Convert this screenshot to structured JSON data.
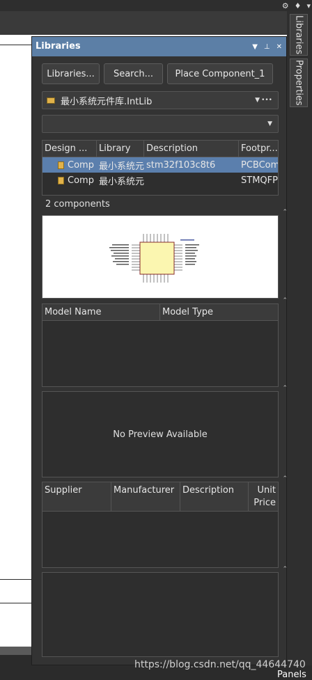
{
  "top_icons": [
    "gear-icon",
    "bell-icon",
    "user-icon"
  ],
  "panel": {
    "title": "Libraries",
    "buttons": {
      "libraries": "Libraries...",
      "search": "Search...",
      "place": "Place Component_1"
    },
    "library_select": "最小系统元件库.IntLib",
    "filter_value": "",
    "table": {
      "headers": [
        "Design ...",
        "Library",
        "Description",
        "Footpr..."
      ],
      "rows": [
        [
          "Comp",
          "最小系统元",
          "stm32f103c8t6",
          "PCBCom"
        ],
        [
          "Comp",
          "最小系统元",
          "",
          "STMQFP"
        ]
      ]
    },
    "count_text": "2 components",
    "models": {
      "headers": [
        "Model Name",
        "Model Type"
      ]
    },
    "no_preview": "No Preview Available",
    "supplier": {
      "headers": [
        "Supplier",
        "Manufacturer",
        "Description",
        "Unit Price"
      ]
    }
  },
  "side_tabs": [
    "Libraries",
    "Properties"
  ],
  "watermark": "https://blog.csdn.net/qq_44644740",
  "panels_label": "Panels"
}
